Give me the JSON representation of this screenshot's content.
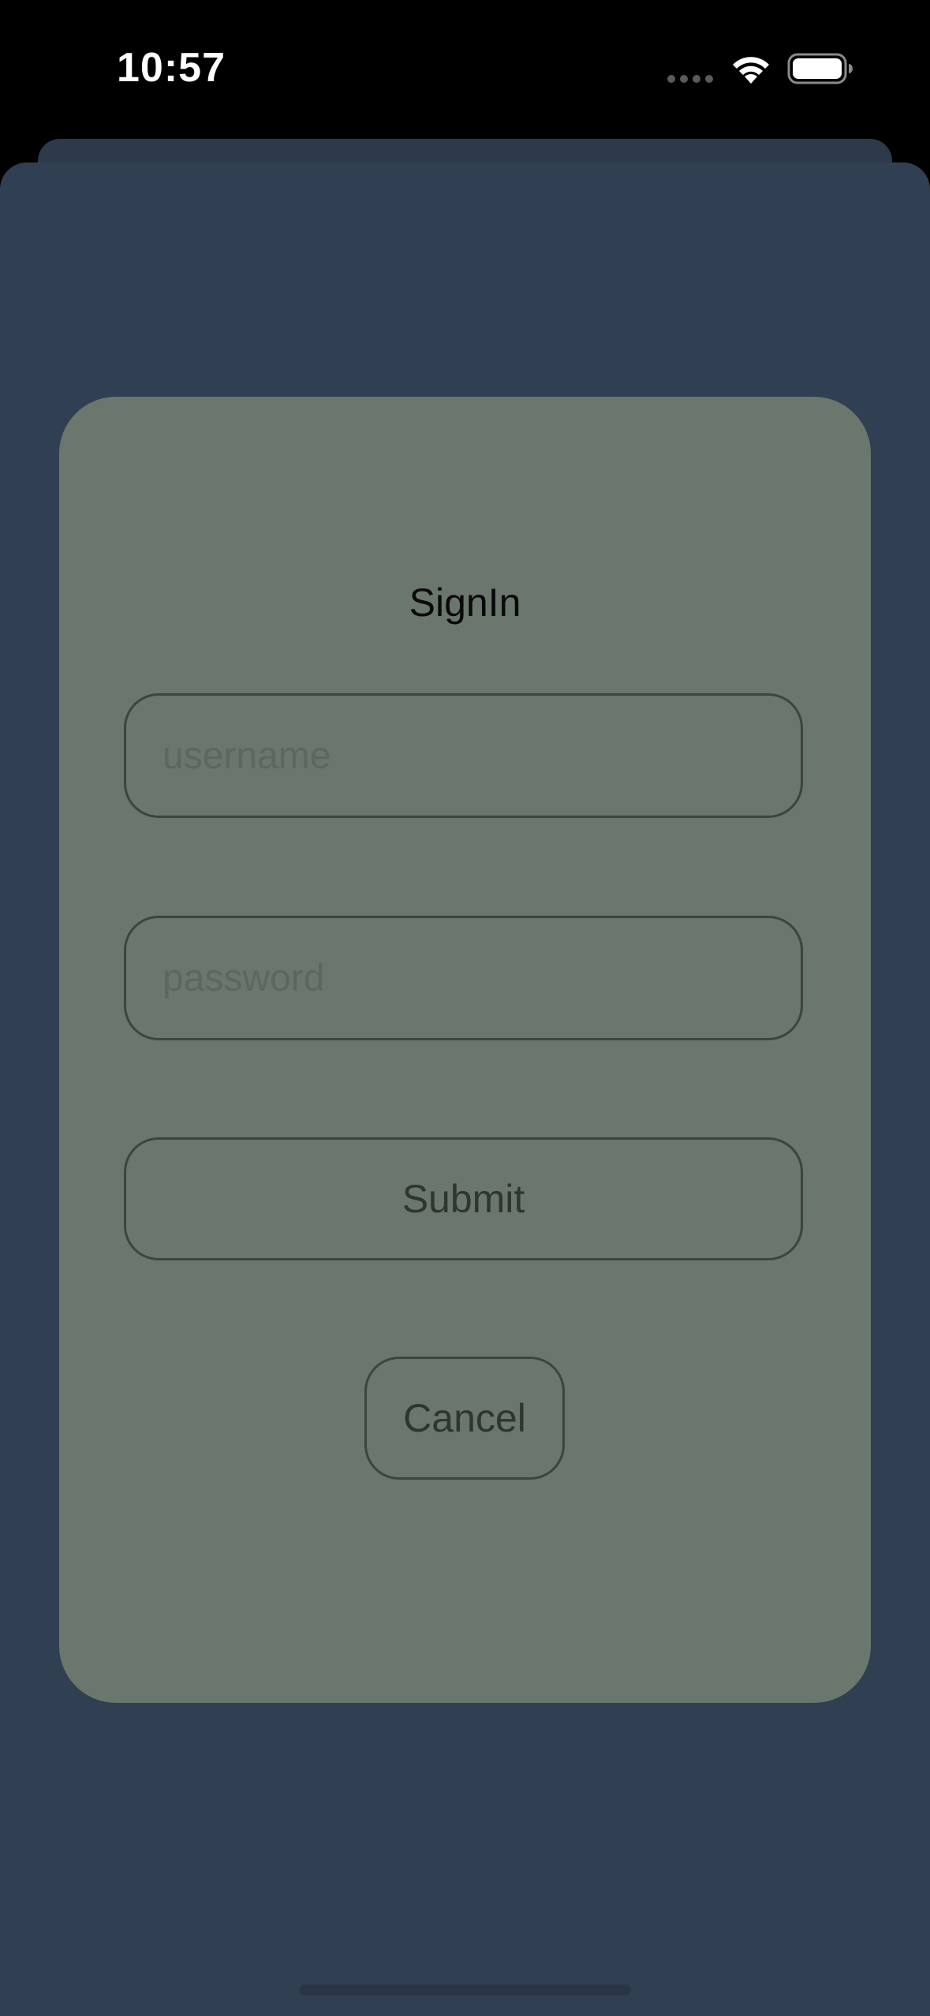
{
  "status_bar": {
    "time": "10:57",
    "icons": [
      "cellular-signal-icon",
      "wifi-icon",
      "battery-icon"
    ]
  },
  "signin": {
    "title": "SignIn",
    "username_placeholder": "username",
    "password_placeholder": "password",
    "username_value": "",
    "password_value": "",
    "submit_label": "Submit",
    "cancel_label": "Cancel"
  },
  "colors": {
    "status_bar_bg": "#000000",
    "sheet_bg": "#313f52",
    "card_bg": "#6b766d",
    "border": "#3e443f",
    "button_text": "#2f3530",
    "placeholder": "#5d675f"
  }
}
